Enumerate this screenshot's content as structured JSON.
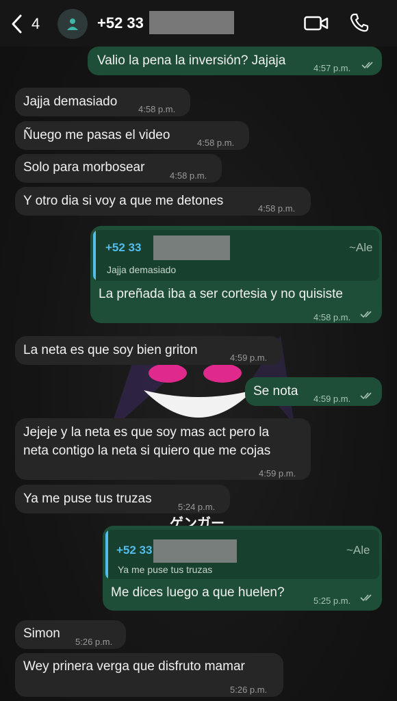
{
  "header": {
    "back_count": "4",
    "contact_name": "+52 33"
  },
  "wallpaper": {
    "text": "ゲンガー"
  },
  "messages": [
    {
      "dir": "out",
      "text": "Valio la pena la inversión? Jajaja",
      "time": "4:57 p.m."
    },
    {
      "dir": "in",
      "text": "Jajja demasiado",
      "time": "4:58 p.m."
    },
    {
      "dir": "in",
      "text": "Ñuego me pasas el video",
      "time": "4:58 p.m."
    },
    {
      "dir": "in",
      "text": "Solo para morbosear",
      "time": "4:58 p.m."
    },
    {
      "dir": "in",
      "text": "Y otro dia si voy a que me detones",
      "time": "4:58 p.m."
    },
    {
      "dir": "out",
      "quote": {
        "name": "+52 33",
        "alias": "~Ale",
        "text": "Jajja demasiado"
      },
      "text": "La preñada iba a ser cortesia y no quisiste",
      "time": "4:58 p.m."
    },
    {
      "dir": "in",
      "text": "La neta es que soy bien griton",
      "time": "4:59 p.m."
    },
    {
      "dir": "out",
      "text": "Se nota",
      "time": "4:59 p.m."
    },
    {
      "dir": "in",
      "line1": "Jejeje y la neta es que soy mas act pero la",
      "line2": "neta contigo la neta si quiero que me cojas",
      "time": "4:59 p.m."
    },
    {
      "dir": "in",
      "text": "Ya me puse tus truzas",
      "time": "5:24 p.m."
    },
    {
      "dir": "out",
      "quote": {
        "name": "+52 33",
        "alias": "~Ale",
        "text": "Ya me puse tus truzas"
      },
      "text": "Me dices luego a que huelen?",
      "time": "5:25 p.m."
    },
    {
      "dir": "in",
      "text": "Simon",
      "time": "5:26 p.m."
    },
    {
      "dir": "in",
      "text": "Wey prinera verga que disfruto mamar",
      "time": "5:26 p.m."
    }
  ],
  "colors": {
    "incoming": "#262626",
    "outgoing": "#1f4e38",
    "quote_accent": "#53bdeb",
    "read_ticks": "#a9c4b5"
  }
}
